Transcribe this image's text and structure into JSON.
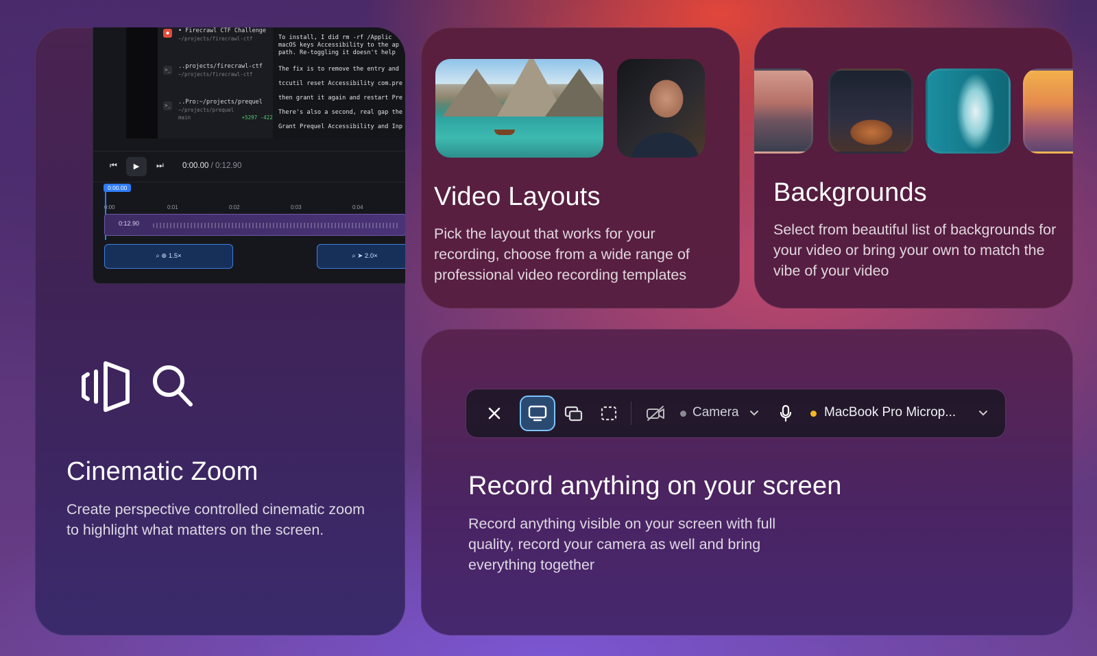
{
  "cards": {
    "zoom": {
      "title": "Cinematic Zoom",
      "description": "Create perspective controlled cinematic zoom to highlight what matters on the screen."
    },
    "layouts": {
      "title": "Video Layouts",
      "description": "Pick the layout that works for your recording, choose from a wide range of professional video recording templates"
    },
    "backgrounds": {
      "title": "Backgrounds",
      "description": "Select from beautiful list of backgrounds for your video or bring your own to match the vibe of your video"
    },
    "record": {
      "title": "Record anything on your screen",
      "description": "Record anything visible on your screen with full quality, record your camera as well and bring everything together"
    }
  },
  "editor": {
    "sessions": [
      {
        "name": "• Firecrawl CTF Challenge",
        "path": "~/projects/firecrawl-ctf"
      },
      {
        "name": "..projects/firecrawl-ctf",
        "path": "~/projects/firecrawl-ctf"
      },
      {
        "name": "..Pro:~/projects/prequel",
        "path": "~/projects/prequel",
        "branch": "main",
        "diff": "+5297 -422"
      }
    ],
    "terminal_lines": [
      "To install, I did rm -rf /Applic",
      "macOS keys Accessibility to the ap",
      "path. Re-toggling it doesn't help",
      "The fix is to remove the entry and",
      "tccutil reset Accessibility com.pre",
      "then grant it again and restart Pre",
      "There's also a second, real gap the",
      "Grant Prequel Accessibility and Inp"
    ],
    "current_time": "0:00.00",
    "total_time": "/ 0:12.90",
    "playhead_label": "0:00.00",
    "ticks": [
      "0:00",
      "0:01",
      "0:02",
      "0:03",
      "0:04"
    ],
    "clip_duration": "0:12.90",
    "zoom_segments": [
      "1.5×",
      "2.0×"
    ]
  },
  "toolbar": {
    "camera_label": "Camera",
    "mic_label": "MacBook Pro Microp...",
    "colors": {
      "active_border": "#7cc6ff",
      "mic_dot": "#f5b623",
      "camera_dot": "#8a8a94"
    }
  }
}
